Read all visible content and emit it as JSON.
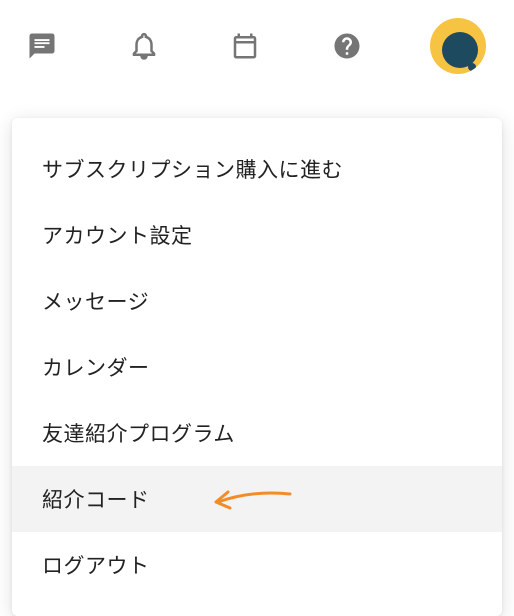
{
  "topbar": {
    "icons": {
      "chat": "chat-icon",
      "bell": "bell-icon",
      "calendar": "calendar-icon",
      "help": "help-icon"
    }
  },
  "menu": {
    "items": [
      {
        "label": "サブスクリプション購入に進む",
        "highlighted": false
      },
      {
        "label": "アカウント設定",
        "highlighted": false
      },
      {
        "label": "メッセージ",
        "highlighted": false
      },
      {
        "label": "カレンダー",
        "highlighted": false
      },
      {
        "label": "友達紹介プログラム",
        "highlighted": false
      },
      {
        "label": "紹介コード",
        "highlighted": true
      },
      {
        "label": "ログアウト",
        "highlighted": false
      }
    ]
  },
  "colors": {
    "arrow": "#F28C28",
    "avatar_bg": "#F6C343",
    "avatar_fg": "#1E4A5F",
    "icon": "#757575"
  }
}
